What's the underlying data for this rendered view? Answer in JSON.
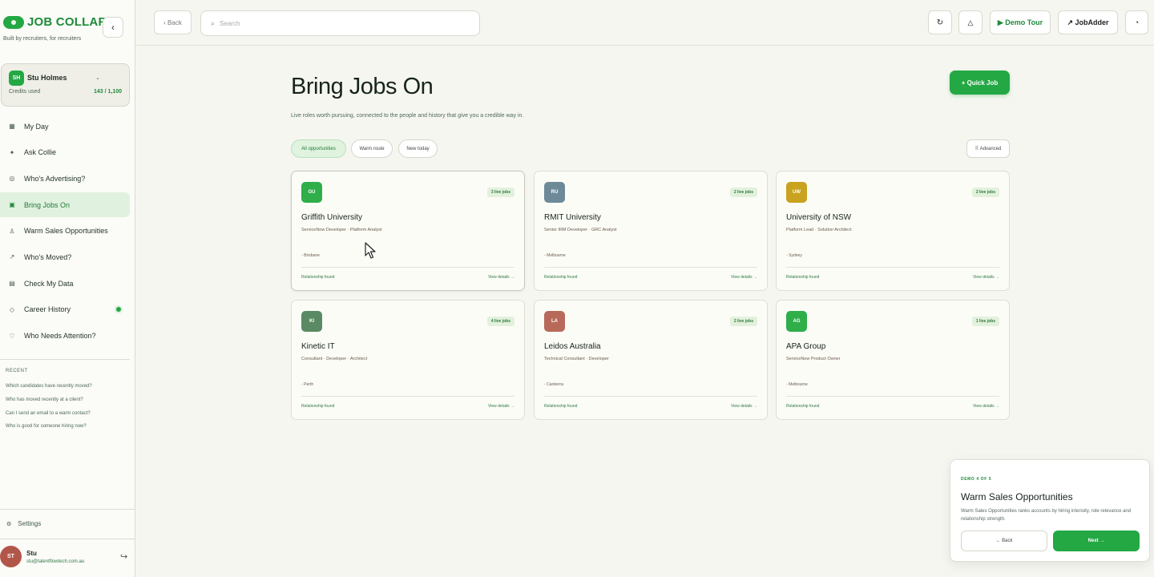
{
  "sidebar": {
    "brand": "JOB COLLAR",
    "tagline": "Built by recruiters, for recruiters",
    "collapse_icon": "chevron-left-icon",
    "user": {
      "initials": "SH",
      "name": "Stu Holmes",
      "credits_label": "Credits used",
      "credits_value": "143 / 1,100"
    },
    "nav": [
      {
        "label": "My Day",
        "icon": "calendar-icon",
        "glyph": "▦"
      },
      {
        "label": "Ask Collie",
        "icon": "sparkle-icon",
        "glyph": "✦"
      },
      {
        "label": "Who's Advertising?",
        "icon": "target-icon",
        "glyph": "◎"
      },
      {
        "label": "Bring Jobs On",
        "icon": "briefcase-icon",
        "glyph": "▣",
        "active": true
      },
      {
        "label": "Warm Sales Opportunities",
        "icon": "person-icon",
        "glyph": "♙"
      },
      {
        "label": "Who's Moved?",
        "icon": "arrow-icon",
        "glyph": "↗"
      },
      {
        "label": "Check My Data",
        "icon": "database-icon",
        "glyph": "▤"
      },
      {
        "label": "Career History",
        "icon": "diamond-icon",
        "glyph": "◇",
        "dot": true
      },
      {
        "label": "Who Needs Attention?",
        "icon": "heart-icon",
        "glyph": "♡"
      }
    ],
    "recent_title": "RECENT",
    "recent": [
      "Which candidates have recently moved?",
      "Who has moved recently at a client?",
      "Can I send an email to a warm contact?",
      "Who is good for someone hiring now?"
    ],
    "settings_label": "Settings",
    "footer": {
      "initials": "ST",
      "name": "Stu",
      "email": "stu@talentflowtech.com.au"
    }
  },
  "topbar": {
    "back_label": "‹ Back",
    "search_placeholder": "Search",
    "demo_tour_label": "▶ Demo Tour",
    "jobadder_label": "↗ JobAdder"
  },
  "main": {
    "title": "Bring Jobs On",
    "subtitle": "Live roles worth pursuing, connected to the people and history that give you a credible way in.",
    "quick_job_label": "+ Quick Job",
    "filters": [
      "All opportunities",
      "Warm route",
      "New today"
    ],
    "advanced_label": "⠿ Advanced",
    "cards": [
      {
        "initials": "GU",
        "color": "#2fae4a",
        "badge": "3 live jobs",
        "name": "Griffith University",
        "roles": "ServiceNow Developer · Platform Analyst",
        "location": "◦ Brisbane",
        "relationship": "Relationship found",
        "view": "View details →"
      },
      {
        "initials": "RU",
        "color": "#6e8a99",
        "badge": "2 live jobs",
        "name": "RMIT University",
        "roles": "Senior IRM Developer · GRC Analyst",
        "location": "◦ Melbourne",
        "relationship": "Relationship found",
        "view": "View details →"
      },
      {
        "initials": "UW",
        "color": "#c9a21f",
        "badge": "2 live jobs",
        "name": "University of NSW",
        "roles": "Platform Lead · Solution Architect",
        "location": "◦ Sydney",
        "relationship": "Relationship found",
        "view": "View details →"
      },
      {
        "initials": "KI",
        "color": "#5a8a63",
        "badge": "4 live jobs",
        "name": "Kinetic IT",
        "roles": "Consultant · Developer · Architect",
        "location": "◦ Perth",
        "relationship": "Relationship found",
        "view": "View details →"
      },
      {
        "initials": "LA",
        "color": "#b86a5a",
        "badge": "2 live jobs",
        "name": "Leidos Australia",
        "roles": "Technical Consultant · Developer",
        "location": "◦ Canberra",
        "relationship": "Relationship found",
        "view": "View details →"
      },
      {
        "initials": "AG",
        "color": "#2fae4a",
        "badge": "1 live jobs",
        "name": "APA Group",
        "roles": "ServiceNow Product Owner",
        "location": "◦ Melbourne",
        "relationship": "Relationship found",
        "view": "View details →"
      }
    ]
  },
  "demo": {
    "step": "DEMO 4 OF 5",
    "title": "Warm Sales Opportunities",
    "body": "Warm Sales Opportunities ranks accounts by hiring intensity, role relevance and relationship strength.",
    "back_label": "← Back",
    "next_label": "Next →"
  },
  "colors": {
    "accent": "#23a844",
    "brand_text": "#1f8a3a",
    "active_nav_bg": "#e1f1df"
  }
}
